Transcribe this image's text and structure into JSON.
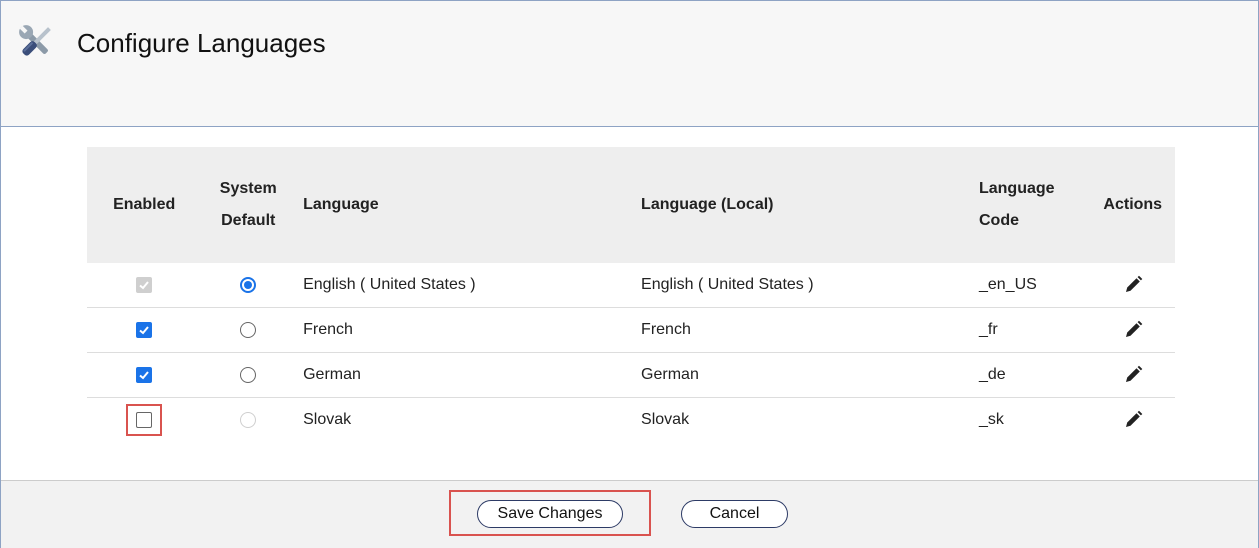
{
  "header": {
    "title": "Configure Languages",
    "icon": "tools-icon"
  },
  "table": {
    "columns": {
      "enabled": "Enabled",
      "system_default_1": "System",
      "system_default_2": "Default",
      "language": "Language",
      "language_local": "Language (Local)",
      "code_1": "Language",
      "code_2": "Code",
      "actions": "Actions"
    },
    "rows": [
      {
        "enabled": "checked-disabled",
        "default": "selected",
        "language": "English ( United States )",
        "local": "English ( United States )",
        "code": "_en_US"
      },
      {
        "enabled": "checked",
        "default": "unselected",
        "language": "French",
        "local": "French",
        "code": "_fr"
      },
      {
        "enabled": "checked",
        "default": "unselected",
        "language": "German",
        "local": "German",
        "code": "_de"
      },
      {
        "enabled": "unchecked",
        "default": "disabled",
        "language": "Slovak",
        "local": "Slovak",
        "code": "_sk"
      }
    ]
  },
  "footer": {
    "save_label": "Save Changes",
    "cancel_label": "Cancel"
  },
  "colors": {
    "accent": "#1a73e8",
    "highlight": "#d9534f",
    "border": "#8ea3c4"
  }
}
